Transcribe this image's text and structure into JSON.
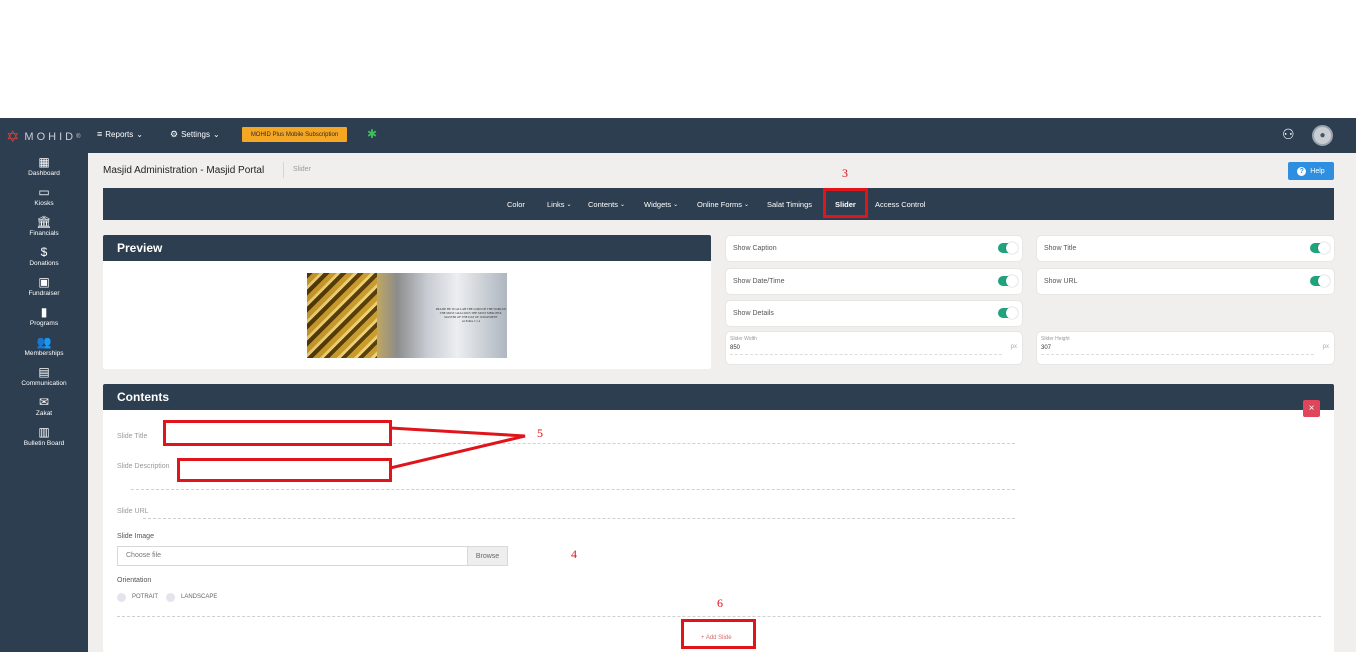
{
  "topbar": {
    "logo_text": "MOHID",
    "logo_reg": "®",
    "reports": "Reports",
    "settings": "Settings",
    "subscription": "MOHID Plus Mobile Subscription"
  },
  "sidebar": {
    "items": [
      {
        "label": "Dashboard",
        "icon": "▦"
      },
      {
        "label": "Kiosks",
        "icon": "▭"
      },
      {
        "label": "Financials",
        "icon": "🏛"
      },
      {
        "label": "Donations",
        "icon": "$"
      },
      {
        "label": "Fundraiser",
        "icon": "▣"
      },
      {
        "label": "Programs",
        "icon": "▮"
      },
      {
        "label": "Memberships",
        "icon": "👥"
      },
      {
        "label": "Communication",
        "icon": "▤"
      },
      {
        "label": "Zakat",
        "icon": "✉"
      },
      {
        "label": "Bulletin Board",
        "icon": "▥"
      }
    ]
  },
  "header": {
    "title": "Masjid Administration - Masjid Portal",
    "crumb": "Slider",
    "help": "Help"
  },
  "tabs": [
    "Color",
    "Links",
    "Contents",
    "Widgets",
    "Online Forms",
    "Salat Timings",
    "Slider",
    "Access Control"
  ],
  "annotations": {
    "n3": "3",
    "n4": "4",
    "n5": "5",
    "n6": "6"
  },
  "preview": {
    "title": "Preview",
    "image_text": "PRAISE BE TO ALLAH THE LORD OF THE WORLDS THE MOST GRACIOUS THE MOST MERCIFUL MASTER OF THE DAY OF JUDGEMENT",
    "image_caption": "Al-Fatiha 1:1-4"
  },
  "toggles": {
    "show_caption": "Show Caption",
    "show_title": "Show Title",
    "show_datetime": "Show Date/Time",
    "show_url": "Show URL",
    "show_details": "Show Details",
    "all_on": true
  },
  "size": {
    "width_label": "Slider Width",
    "width_value": "850",
    "height_label": "Slider Height",
    "height_value": "307",
    "unit": "px"
  },
  "contents": {
    "title": "Contents",
    "slide_title": "Slide Title",
    "slide_description": "Slide Description",
    "slide_url": "Slide URL",
    "slide_image": "Slide Image",
    "choose_file": "Choose file",
    "browse": "Browse",
    "orientation": "Orientation",
    "portrait": "POTRAIT",
    "landscape": "LANDSCAPE",
    "add_slide": "+ Add Slide",
    "remove": "×"
  }
}
